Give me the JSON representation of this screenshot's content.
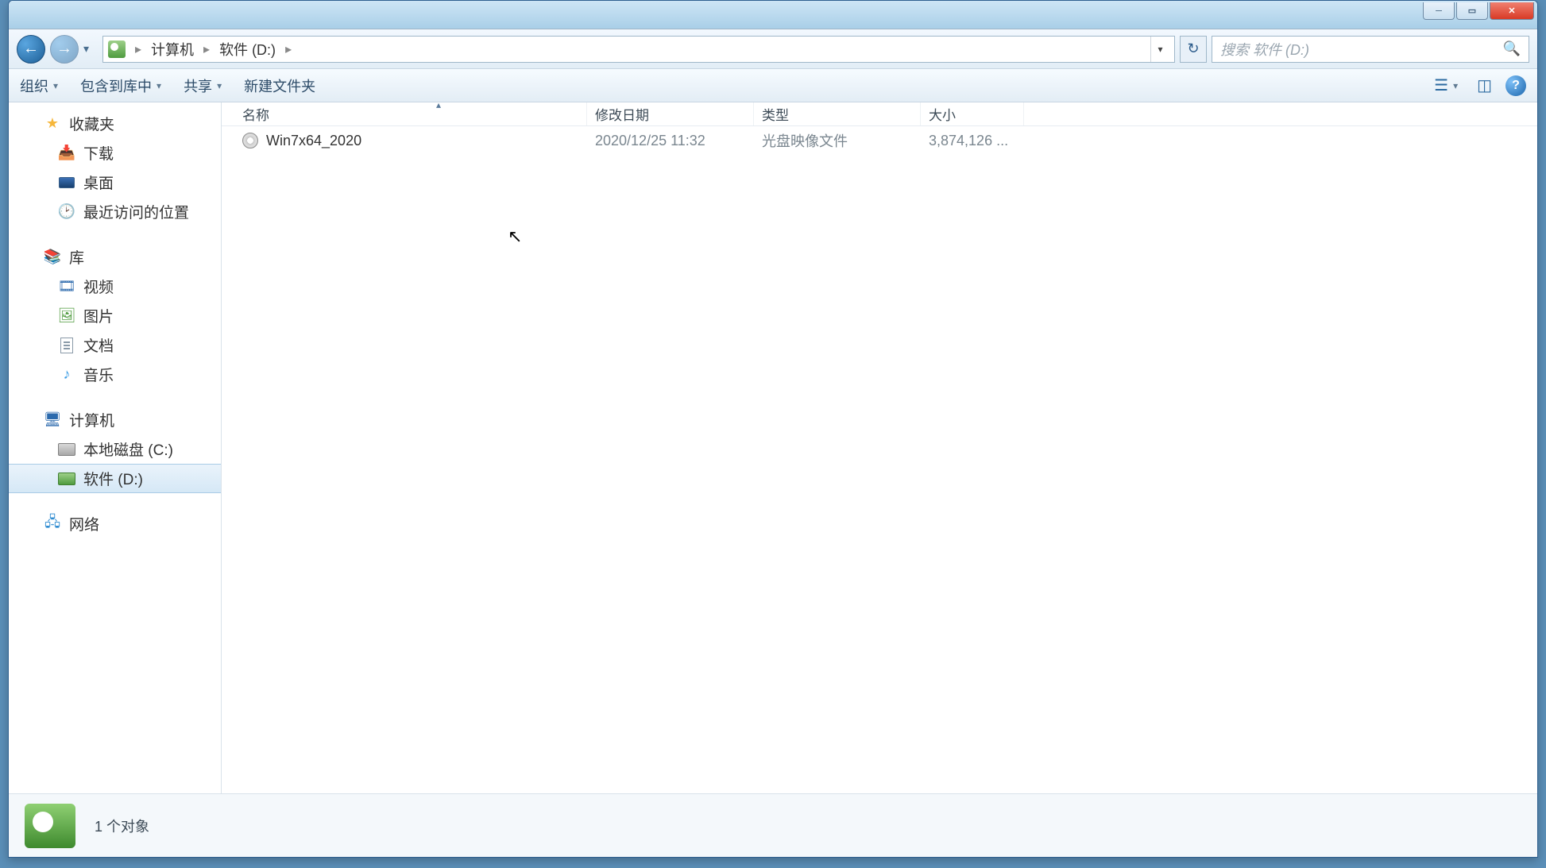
{
  "window_title": "",
  "breadcrumb": {
    "parts": [
      "计算机",
      "软件 (D:)"
    ]
  },
  "search_placeholder": "搜索 软件 (D:)",
  "toolbar": {
    "organize": "组织",
    "include": "包含到库中",
    "share": "共享",
    "newfolder": "新建文件夹"
  },
  "columns": {
    "name": "名称",
    "date": "修改日期",
    "type": "类型",
    "size": "大小"
  },
  "files": [
    {
      "name": "Win7x64_2020",
      "date": "2020/12/25 11:32",
      "type": "光盘映像文件",
      "size": "3,874,126 ..."
    }
  ],
  "sidebar": {
    "favorites": {
      "label": "收藏夹",
      "items": [
        {
          "label": "下载"
        },
        {
          "label": "桌面"
        },
        {
          "label": "最近访问的位置"
        }
      ]
    },
    "libraries": {
      "label": "库",
      "items": [
        {
          "label": "视频"
        },
        {
          "label": "图片"
        },
        {
          "label": "文档"
        },
        {
          "label": "音乐"
        }
      ]
    },
    "computer": {
      "label": "计算机",
      "items": [
        {
          "label": "本地磁盘 (C:)"
        },
        {
          "label": "软件 (D:)",
          "selected": true
        }
      ]
    },
    "network": {
      "label": "网络"
    }
  },
  "statusbar": "1 个对象"
}
